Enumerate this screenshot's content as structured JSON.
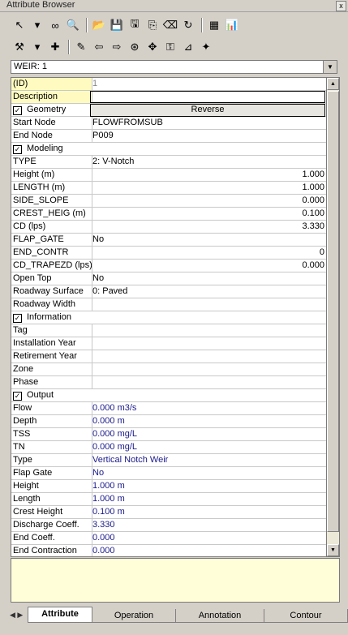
{
  "window": {
    "title": "Attribute Browser",
    "close_glyph": "x"
  },
  "toolbar": {
    "row1": [
      {
        "name": "select-arrow-icon",
        "glyph": "↖"
      },
      {
        "name": "dropdown-caret-icon",
        "glyph": "▾"
      },
      {
        "name": "find-link-icon",
        "glyph": "∞"
      },
      {
        "name": "zoom-icon",
        "glyph": "🔍"
      },
      {
        "name": "open-folder-icon",
        "glyph": "📂"
      },
      {
        "name": "save-icon",
        "glyph": "💾"
      },
      {
        "name": "save-as-icon",
        "glyph": "🖫"
      },
      {
        "name": "copy-icon",
        "glyph": "⎘"
      },
      {
        "name": "eraser-icon",
        "glyph": "⌫"
      },
      {
        "name": "refresh-icon",
        "glyph": "↻"
      },
      {
        "name": "table-icon",
        "glyph": "▦"
      },
      {
        "name": "bar-chart-icon",
        "glyph": "📊"
      }
    ],
    "row2": [
      {
        "name": "hammer-icon",
        "glyph": "⚒"
      },
      {
        "name": "dropdown-caret-icon",
        "glyph": "▾"
      },
      {
        "name": "add-node-icon",
        "glyph": "✚"
      },
      {
        "name": "pencil-edit-icon",
        "glyph": "✎"
      },
      {
        "name": "arrow-left-icon",
        "glyph": "⇦"
      },
      {
        "name": "arrow-right-icon",
        "glyph": "⇨"
      },
      {
        "name": "globe-refresh-icon",
        "glyph": "⊛"
      },
      {
        "name": "split-arrows-icon",
        "glyph": "✥"
      },
      {
        "name": "key-icon",
        "glyph": "⚿"
      },
      {
        "name": "chart-axis-icon",
        "glyph": "⊿"
      },
      {
        "name": "paint-icon",
        "glyph": "✦"
      }
    ]
  },
  "selector": {
    "value": "WEIR: 1"
  },
  "rows": [
    {
      "type": "id",
      "label": "(ID)",
      "value": "1"
    },
    {
      "type": "desc",
      "label": "Description",
      "value": ""
    },
    {
      "type": "section",
      "label": "Geometry",
      "button": "Reverse"
    },
    {
      "label": "Start Node",
      "value": "FLOWFROMSUB"
    },
    {
      "label": "End Node",
      "value": "P009"
    },
    {
      "type": "section",
      "label": "Modeling"
    },
    {
      "label": "TYPE",
      "value": "2: V-Notch"
    },
    {
      "label": "Height (m)",
      "value": "1.000",
      "num": true
    },
    {
      "label": "LENGTH (m)",
      "value": "1.000",
      "num": true
    },
    {
      "label": "SIDE_SLOPE",
      "value": "0.000",
      "num": true
    },
    {
      "label": "CREST_HEIG (m)",
      "value": "0.100",
      "num": true
    },
    {
      "label": "CD (lps)",
      "value": "3.330",
      "num": true
    },
    {
      "label": "FLAP_GATE",
      "value": "No"
    },
    {
      "label": "END_CONTR",
      "value": "0",
      "num": true
    },
    {
      "label": "CD_TRAPEZD (lps)",
      "value": "0.000",
      "num": true
    },
    {
      "label": "Open Top",
      "value": "No"
    },
    {
      "label": "Roadway Surface",
      "value": "0: Paved"
    },
    {
      "label": "Roadway Width",
      "value": ""
    },
    {
      "type": "section",
      "label": "Information"
    },
    {
      "label": "Tag",
      "value": ""
    },
    {
      "label": "Installation Year",
      "value": ""
    },
    {
      "label": "Retirement Year",
      "value": ""
    },
    {
      "label": "Zone",
      "value": ""
    },
    {
      "label": "Phase",
      "value": ""
    },
    {
      "type": "section",
      "label": "Output"
    },
    {
      "label": "Flow",
      "value": "0.000 m3/s",
      "out": true
    },
    {
      "label": "Depth",
      "value": "0.000 m",
      "out": true
    },
    {
      "label": "TSS",
      "value": "0.000 mg/L",
      "out": true
    },
    {
      "label": "TN",
      "value": "0.000 mg/L",
      "out": true
    },
    {
      "label": "Type",
      "value": "Vertical Notch Weir",
      "out": true
    },
    {
      "label": "Flap Gate",
      "value": "No",
      "out": true
    },
    {
      "label": "Height",
      "value": "1.000 m",
      "out": true
    },
    {
      "label": "Length",
      "value": "1.000 m",
      "out": true
    },
    {
      "label": "Crest Height",
      "value": "0.100 m",
      "out": true
    },
    {
      "label": "Discharge Coeff.",
      "value": "3.330",
      "out": true
    },
    {
      "label": "End Coeff.",
      "value": "0.000",
      "out": true
    },
    {
      "label": "End Contraction",
      "value": "0.000",
      "out": true
    }
  ],
  "check_glyph": "✓",
  "scroll": {
    "up_glyph": "▲",
    "down_glyph": "▼"
  },
  "tab_nav": "◀ ▶",
  "tabs": [
    {
      "label": "Attribute",
      "active": true
    },
    {
      "label": "Operation",
      "active": false
    },
    {
      "label": "Annotation",
      "active": false
    },
    {
      "label": "Contour",
      "active": false
    }
  ]
}
